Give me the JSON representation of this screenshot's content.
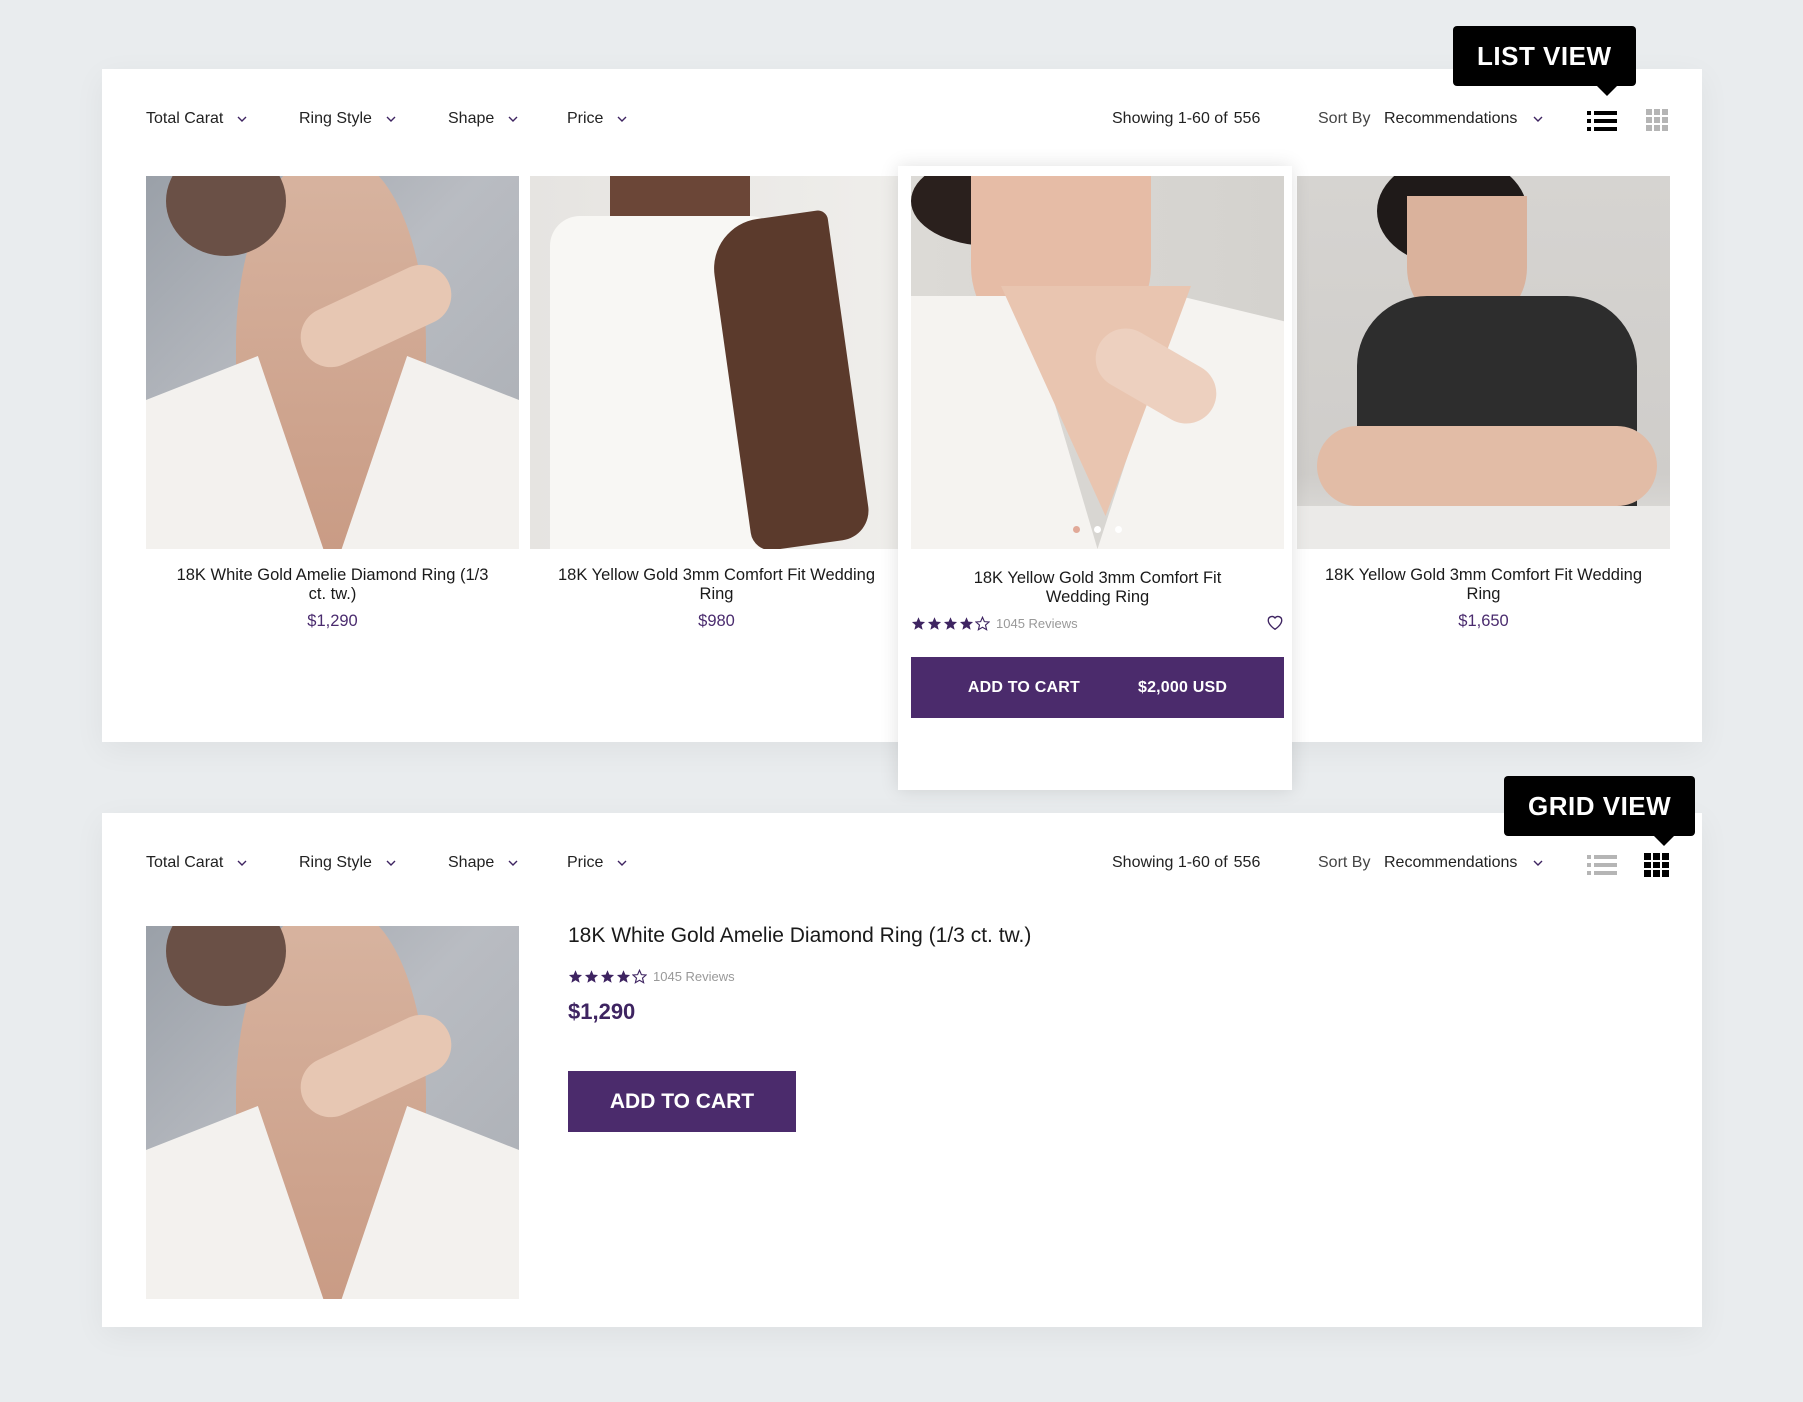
{
  "colors": {
    "accent": "#4b2b6c",
    "price": "#4a2b6e",
    "page_bg": "#e9ecee",
    "star": "#3e2461",
    "tooltip_bg": "#000000"
  },
  "filters": [
    {
      "label": "Total Carat",
      "icon": "chevron-down-icon"
    },
    {
      "label": "Ring Style",
      "icon": "chevron-down-icon"
    },
    {
      "label": "Shape",
      "icon": "chevron-down-icon"
    },
    {
      "label": "Price",
      "icon": "chevron-down-icon"
    }
  ],
  "results": {
    "prefix": "Showing 1-60 of",
    "total": "556"
  },
  "sort": {
    "label": "Sort By",
    "value": "Recommendations"
  },
  "view_toggle": {
    "list_icon": "list-view-icon",
    "grid_icon": "grid-view-icon"
  },
  "list_section": {
    "tooltip": "LIST VIEW",
    "active_view": "list",
    "products": [
      {
        "title": "18K White Gold Amelie Diamond Ring (1/3 ct. tw.)",
        "price": "$1,290"
      },
      {
        "title": "18K Yellow Gold 3mm Comfort Fit Wedding Ring",
        "price": "$980"
      },
      {
        "title": "18K Yellow Gold 3mm Comfort Fit Wedding Ring",
        "price": "$2,000 USD",
        "rating": 4,
        "rating_max": 5,
        "reviews": "1045 Reviews",
        "hovered": true,
        "carousel_dots": 3,
        "carousel_active": 1,
        "add_to_cart": "ADD TO CART",
        "wishlist_icon": "heart-icon"
      },
      {
        "title": "18K Yellow Gold 3mm Comfort Fit Wedding Ring",
        "price": "$1,650"
      }
    ]
  },
  "grid_section": {
    "tooltip": "GRID VIEW",
    "active_view": "grid",
    "product": {
      "title": "18K White Gold Amelie Diamond Ring (1/3 ct. tw.)",
      "rating": 4,
      "rating_max": 5,
      "reviews": "1045 Reviews",
      "price": "$1,290",
      "add_to_cart": "ADD TO CART"
    }
  }
}
